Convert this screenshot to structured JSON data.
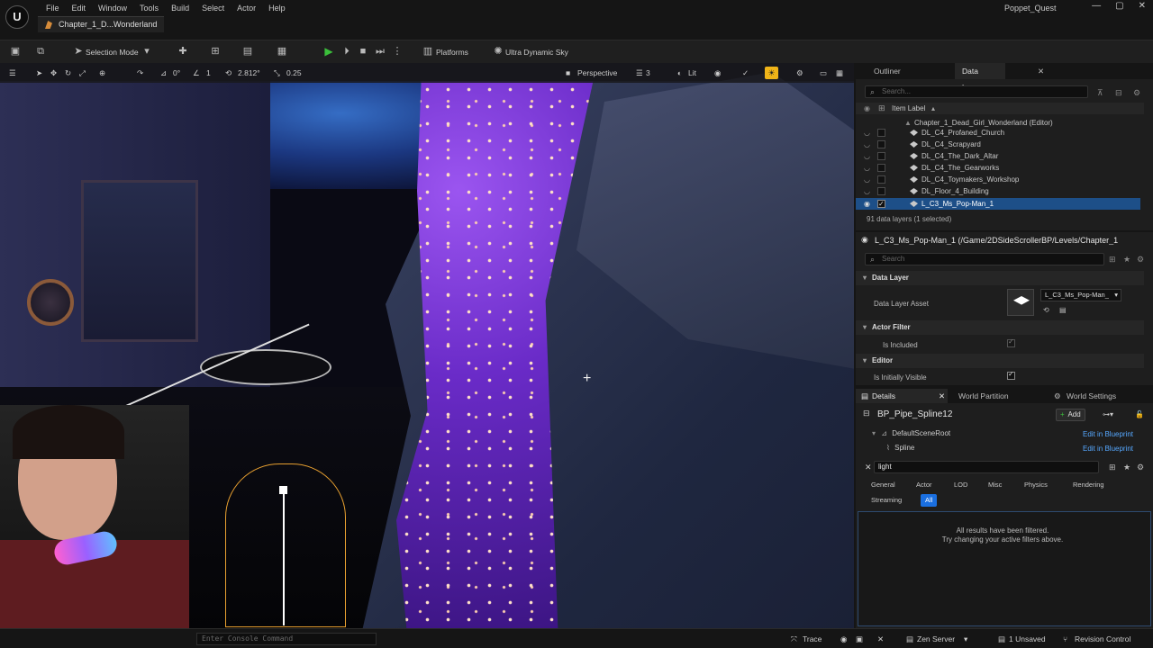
{
  "app": {
    "menu": [
      "File",
      "Edit",
      "Window",
      "Tools",
      "Build",
      "Select",
      "Actor",
      "Help"
    ],
    "doc_tab": "Chapter_1_D...Wonderland",
    "project": "Poppet_Quest",
    "win_controls": [
      "—",
      "▢",
      "✕"
    ]
  },
  "toolbar": {
    "selection_mode": "Selection Mode",
    "platforms": "Platforms",
    "sky": "Ultra Dynamic Sky"
  },
  "viewport": {
    "grid_snap": "0°",
    "rot_snap": "1",
    "scale_value": "2.812°",
    "scale_snap": "0.25",
    "view_mode": "Perspective",
    "camera_speed": "3",
    "lit": "Lit"
  },
  "statusbar": {
    "console_placeholder": "Enter Console Command",
    "trace": "Trace",
    "zen": "Zen Server",
    "unsaved": "1 Unsaved",
    "revision": "Revision Control"
  },
  "outliner": {
    "tabs": [
      "Outliner",
      "Data Layers"
    ],
    "search_placeholder": "Search...",
    "column": "Item Label",
    "root": "Chapter_1_Dead_Girl_Wonderland (Editor)",
    "items": [
      {
        "label": "DL_C4_Profaned_Church"
      },
      {
        "label": "DL_C4_Scrapyard"
      },
      {
        "label": "DL_C4_The_Dark_Altar"
      },
      {
        "label": "DL_C4_The_Gearworks"
      },
      {
        "label": "DL_C4_Toymakers_Workshop"
      },
      {
        "label": "DL_Floor_4_Building"
      },
      {
        "label": "L_C3_Ms_Pop-Man_1"
      }
    ],
    "count": "91 data layers (1 selected)"
  },
  "datalayer_details": {
    "title": "L_C3_Ms_Pop-Man_1 (/Game/2DSideScrollerBP/Levels/Chapter_1",
    "search_placeholder": "Search",
    "section_data_layer": "Data Layer",
    "asset_label": "Data Layer Asset",
    "asset_value": "L_C3_Ms_Pop-Man_",
    "section_actor_filter": "Actor Filter",
    "is_included": "Is Included",
    "section_editor": "Editor",
    "initially_visible": "Is Initially Visible"
  },
  "details": {
    "tabs": [
      "Details",
      "World Partition",
      "World Settings"
    ],
    "actor_name": "BP_Pipe_Spline12",
    "add_label": "Add",
    "components": [
      {
        "name": "DefaultSceneRoot",
        "link": "Edit in Blueprint"
      },
      {
        "name": "Spline",
        "link": "Edit in Blueprint"
      }
    ],
    "search_value": "light",
    "filters": [
      "General",
      "Actor",
      "LOD",
      "Misc",
      "Physics",
      "Rendering",
      "Streaming",
      "All"
    ],
    "empty_line1": "All results have been filtered.",
    "empty_line2": "Try changing your active filters above."
  }
}
